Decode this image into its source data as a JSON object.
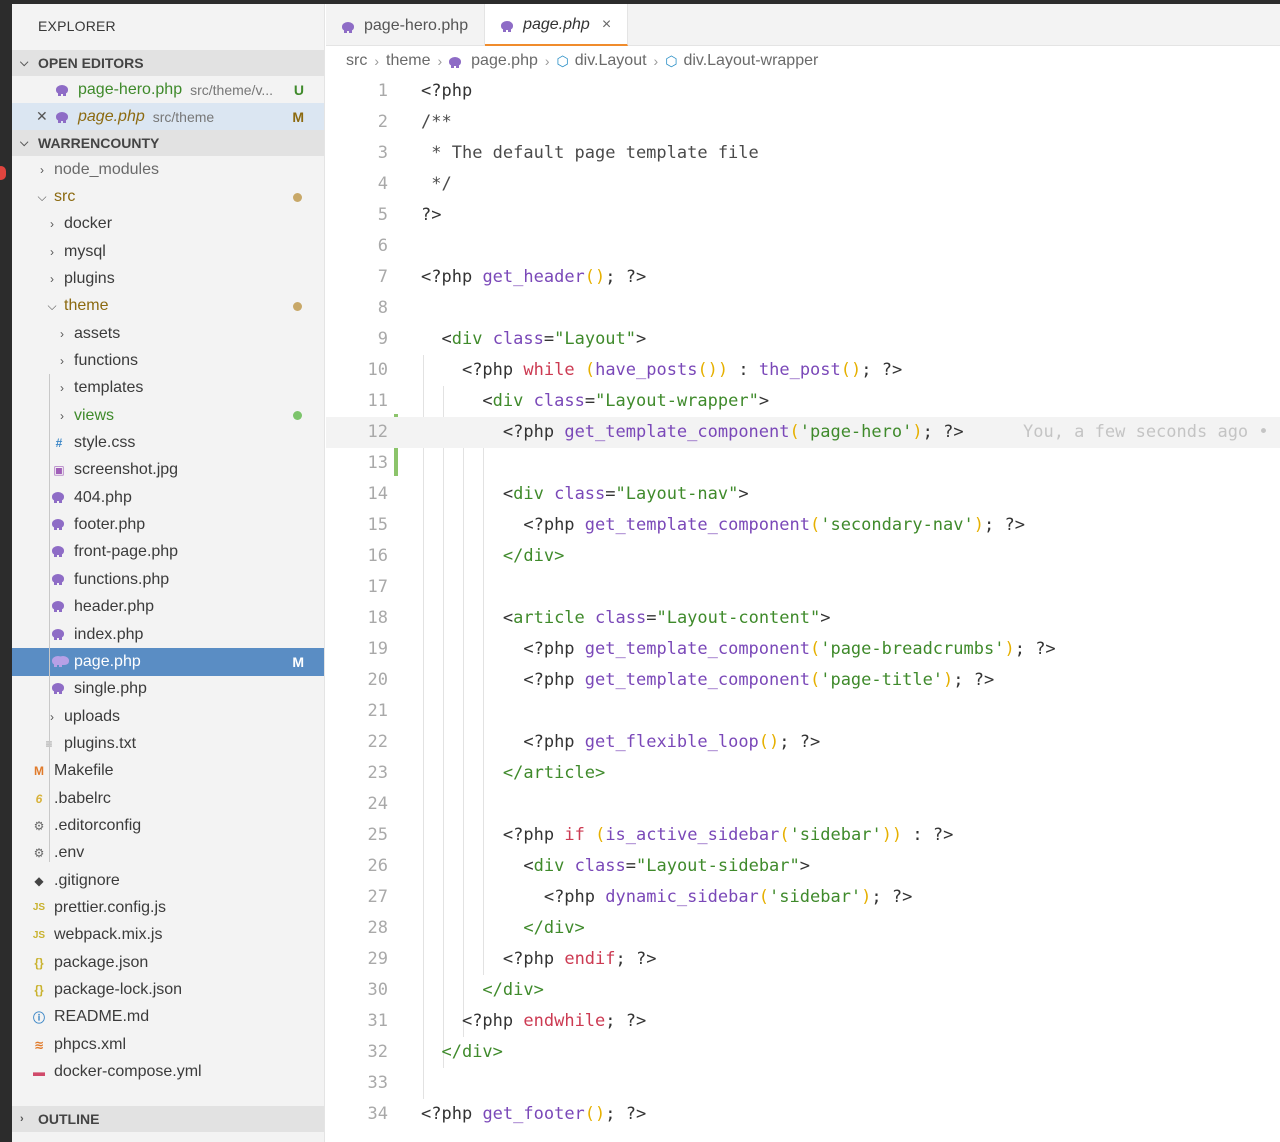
{
  "explorer": {
    "title": "EXPLORER",
    "open_editors_header": "OPEN EDITORS",
    "open_editors": [
      {
        "name": "page-hero.php",
        "path": "src/theme/v...",
        "badge": "U"
      },
      {
        "name": "page.php",
        "path": "src/theme",
        "badge": "M"
      }
    ],
    "project_header": "WARRENCOUNTY",
    "tree": [
      {
        "label": "node_modules"
      },
      {
        "label": "src"
      },
      {
        "label": "docker"
      },
      {
        "label": "mysql"
      },
      {
        "label": "plugins"
      },
      {
        "label": "theme"
      },
      {
        "label": "assets"
      },
      {
        "label": "functions"
      },
      {
        "label": "templates"
      },
      {
        "label": "views"
      },
      {
        "label": "style.css"
      },
      {
        "label": "screenshot.jpg"
      },
      {
        "label": "404.php"
      },
      {
        "label": "footer.php"
      },
      {
        "label": "front-page.php"
      },
      {
        "label": "functions.php"
      },
      {
        "label": "header.php"
      },
      {
        "label": "index.php"
      },
      {
        "label": "page.php",
        "badge": "M"
      },
      {
        "label": "single.php"
      },
      {
        "label": "uploads"
      },
      {
        "label": "plugins.txt"
      },
      {
        "label": "Makefile"
      },
      {
        "label": ".babelrc"
      },
      {
        "label": ".editorconfig"
      },
      {
        "label": ".env"
      },
      {
        "label": ".gitignore"
      },
      {
        "label": "prettier.config.js"
      },
      {
        "label": "webpack.mix.js"
      },
      {
        "label": "package.json"
      },
      {
        "label": "package-lock.json"
      },
      {
        "label": "README.md"
      },
      {
        "label": "phpcs.xml"
      },
      {
        "label": "docker-compose.yml"
      }
    ],
    "outline_header": "OUTLINE"
  },
  "tabs": [
    {
      "label": "page-hero.php"
    },
    {
      "label": "page.php",
      "close": "×"
    }
  ],
  "breadcrumb": [
    "src",
    "theme",
    "page.php",
    "div.Layout",
    "div.Layout-wrapper"
  ],
  "blame": "You, a few seconds ago •",
  "line_numbers": [
    "1",
    "2",
    "3",
    "4",
    "5",
    "6",
    "7",
    "8",
    "9",
    "10",
    "11",
    "12",
    "13",
    "14",
    "15",
    "16",
    "17",
    "18",
    "19",
    "20",
    "21",
    "22",
    "23",
    "24",
    "25",
    "26",
    "27",
    "28",
    "29",
    "30",
    "31",
    "32",
    "33",
    "34"
  ],
  "tokens": {
    "php_open": "<?php",
    "php_close": "?>",
    "doc_open": "/**",
    "doc_text": "* The default page template file",
    "doc_close": "*/",
    "get_header": "get_header",
    "get_footer": "get_footer",
    "div": "div",
    "div_close": "</div>",
    "article": "article",
    "article_close": "</article>",
    "class": "class",
    "layout": "\"Layout\"",
    "layout_wrapper": "\"Layout-wrapper\"",
    "layout_nav": "\"Layout-nav\"",
    "layout_content": "\"Layout-content\"",
    "layout_sidebar": "\"Layout-sidebar\"",
    "while": "while",
    "have_posts": "have_posts",
    "the_post": "the_post",
    "gtc": "get_template_component",
    "page_hero": "'page-hero'",
    "secondary_nav": "'secondary-nav'",
    "page_breadcrumbs": "'page-breadcrumbs'",
    "page_title": "'page-title'",
    "flexible": "get_flexible_loop",
    "if": "if",
    "is_active_sidebar": "is_active_sidebar",
    "sidebar_str": "'sidebar'",
    "dynamic_sidebar": "dynamic_sidebar",
    "endif": "endif",
    "endwhile": "endwhile"
  },
  "colors": {
    "keyword": "#cc3a52",
    "tag": "#3f8a2b",
    "function": "#7a48b8",
    "string": "#3f8a2b",
    "bracket": "#e6b000",
    "selection": "#5a8dc4",
    "active_tab_border": "#f08c2c",
    "git_added": "#8cc46b"
  }
}
